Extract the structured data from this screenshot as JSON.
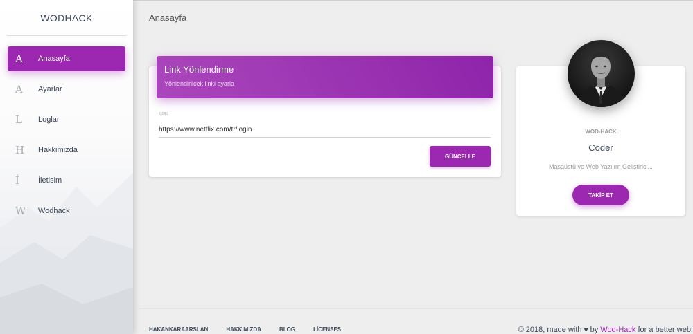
{
  "sidebar": {
    "brand": "WODHACK",
    "items": [
      {
        "letter": "A",
        "label": "Anasayfa",
        "active": true
      },
      {
        "letter": "A",
        "label": "Ayarlar",
        "active": false
      },
      {
        "letter": "L",
        "label": "Loglar",
        "active": false
      },
      {
        "letter": "H",
        "label": "Hakkimizda",
        "active": false
      },
      {
        "letter": "İ",
        "label": "İletisim",
        "active": false
      },
      {
        "letter": "W",
        "label": "Wodhack",
        "active": false
      }
    ]
  },
  "header": {
    "title": "Anasayfa"
  },
  "link_card": {
    "title": "Link Yönlendirme",
    "subtitle": "Yönlendirilcek linki ayarla",
    "field_label": "URL",
    "field_value": "https://www.netflix.com/tr/login",
    "button": "GÜNCELLE"
  },
  "profile_card": {
    "category": "WOD-HACK",
    "name": "Coder",
    "description": "Masaüstü ve Web Yazılım Geliştirici...",
    "button": "TAKİP ET"
  },
  "footer": {
    "links": [
      "HAKANKARAARSLAN",
      "HAKKIMIZDA",
      "BLOG",
      "LİCENSES"
    ],
    "copyright_prefix": "© 2018, made with",
    "by": "by",
    "brand": "Wod-Hack",
    "suffix": "for a better web."
  },
  "colors": {
    "accent": "#9c27b0",
    "background": "#eeeeee"
  }
}
